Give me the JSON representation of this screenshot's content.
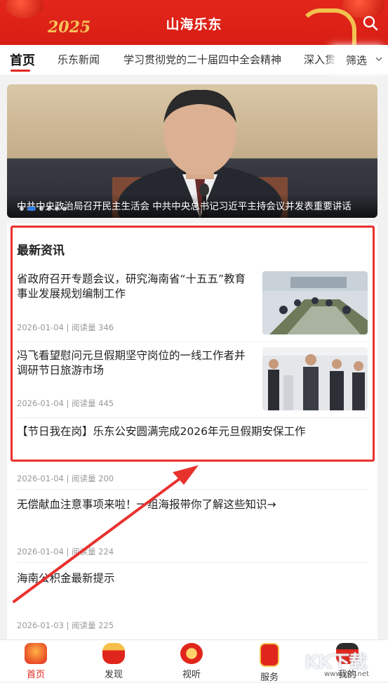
{
  "app": {
    "title": "山海乐东",
    "year_badge": "2025"
  },
  "tabs": [
    {
      "label": "首页"
    },
    {
      "label": "乐东新闻"
    },
    {
      "label": "学习贯彻党的二十届四中全会精神"
    },
    {
      "label": "深入贯"
    }
  ],
  "filter": {
    "label": "筛选"
  },
  "banner": {
    "caption": "中共中央政治局召开民主生活会 中共中央总书记习近平主持会议并发表重要讲话"
  },
  "section": {
    "title": "最新资讯"
  },
  "news": [
    {
      "title": "省政府召开专题会议，研究海南省“十五五”教育事业发展规划编制工作",
      "meta": "2026-01-04 | 阅读量 346"
    },
    {
      "title": "冯飞看望慰问元旦假期坚守岗位的一线工作者并调研节日旅游市场",
      "meta": "2026-01-04 | 阅读量 445"
    },
    {
      "title": "【节日我在岗】乐东公安圆满完成2026年元旦假期安保工作",
      "meta": "2026-01-04 | 阅读量 200"
    },
    {
      "title": "无偿献血注意事项来啦！一组海报带你了解这些知识→",
      "meta": "2026-01-04 | 阅读量 224"
    },
    {
      "title": "海南公积金最新提示",
      "meta": "2026-01-03 | 阅读量 225"
    }
  ],
  "bottom_nav": [
    {
      "label": "首页",
      "icon": "home-drum-icon",
      "active": true
    },
    {
      "label": "发现",
      "icon": "drum-icon"
    },
    {
      "label": "视听",
      "icon": "lion-dance-icon"
    },
    {
      "label": "服务",
      "icon": "fu-lantern-icon"
    },
    {
      "label": "我的",
      "icon": "fortune-god-icon"
    }
  ],
  "watermark": {
    "text": "KK下载",
    "site": "www.kkx.net"
  },
  "colors": {
    "brand_red": "#e0261c",
    "highlight_red": "#e8322e",
    "gold": "#f6c35a"
  }
}
